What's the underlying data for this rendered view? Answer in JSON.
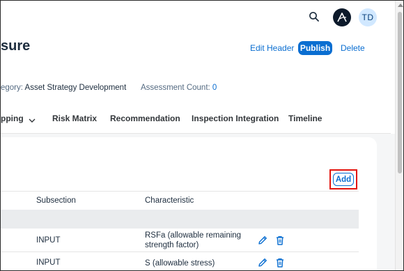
{
  "shell": {
    "search_icon": "search-icon",
    "logo_icon": "brand-logo-icon",
    "user_initials": "TD"
  },
  "header": {
    "title": "sure",
    "edit_header_label": "Edit Header",
    "publish_label": "Publish",
    "delete_label": "Delete",
    "category_label": "egory:",
    "category_value": "Asset Strategy Development",
    "assessment_count_label": "Assessment Count:",
    "assessment_count_value": "0"
  },
  "tabs": [
    {
      "label": "pping"
    },
    {
      "label": "Risk Matrix"
    },
    {
      "label": "Recommendation"
    },
    {
      "label": "Inspection Integration"
    },
    {
      "label": "Timeline"
    }
  ],
  "section": {
    "add_label": "Add"
  },
  "table": {
    "columns": [
      "Subsection",
      "Characteristic"
    ],
    "rows": [
      {
        "subsection": "INPUT",
        "characteristic": "RSFa (allowable remaining strength factor)"
      },
      {
        "subsection": "INPUT",
        "characteristic": "S (allowable stress)"
      }
    ]
  },
  "colors": {
    "accent": "#0a6ed1",
    "highlight": "#e3120b",
    "avatar_bg": "#d1e8ff",
    "logo_bg": "#0d1a2b"
  }
}
